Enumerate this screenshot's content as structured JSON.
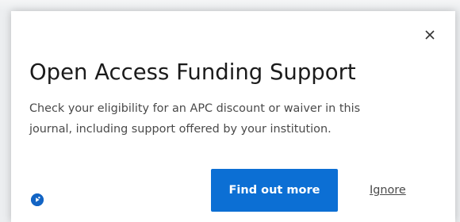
{
  "dialog": {
    "title": "Open Access Funding Support",
    "body_line1": "Check your eligibility for an APC discount or waiver in this",
    "body_line2": "journal, including support offered by your institution.",
    "close_icon": "close-icon",
    "help_icon": "help-icon"
  },
  "actions": {
    "primary_label": "Find out more",
    "secondary_label": "Ignore"
  },
  "colors": {
    "primary_button": "#0c6fd4",
    "help_icon": "#1264c4",
    "title_text": "#1b1b1b",
    "body_text": "#4a4a4a"
  }
}
